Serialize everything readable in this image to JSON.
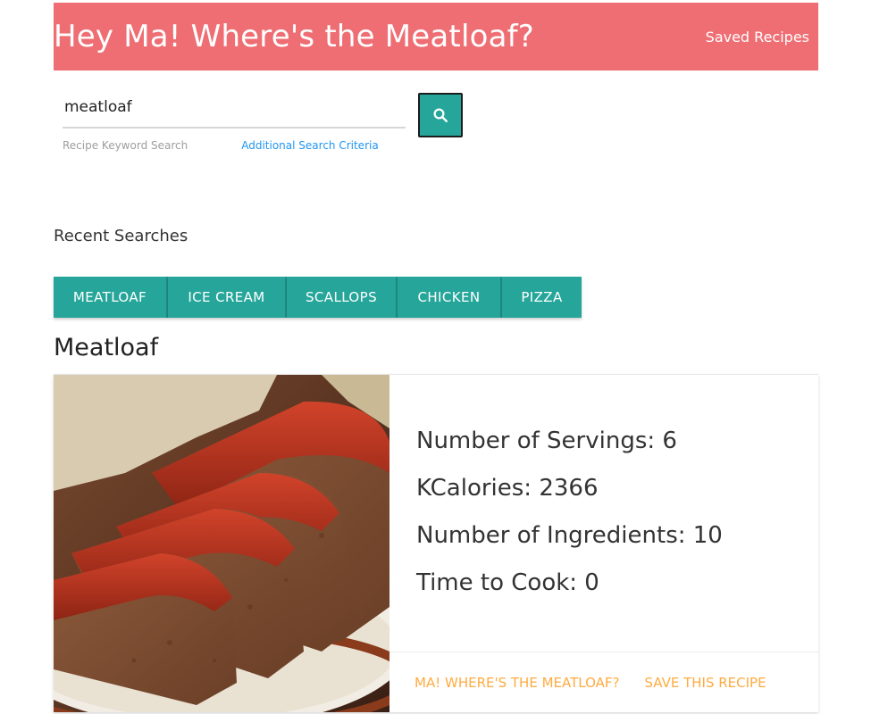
{
  "navbar": {
    "brand": "Hey Ma! Where's the Meatloaf?",
    "saved_link": "Saved Recipes"
  },
  "search": {
    "value": "meatloaf",
    "helper_label": "Recipe Keyword Search",
    "additional_link": "Additional Search Criteria",
    "button_icon": "search-icon"
  },
  "recent": {
    "title": "Recent Searches",
    "chips": [
      "MEATLOAF",
      "ICE CREAM",
      "SCALLOPS",
      "CHICKEN",
      "PIZZA"
    ]
  },
  "recipe": {
    "title": "Meatloaf",
    "image_alt": "meatloaf",
    "stats": {
      "servings": "Number of Servings: 6",
      "kcal": "KCalories: 2366",
      "ingredients": "Number of Ingredients: 10",
      "time": "Time to Cook: 0"
    },
    "actions": {
      "primary": "MA! WHERE'S THE MEATLOAF?",
      "save": "SAVE THIS RECIPE"
    }
  },
  "colors": {
    "navbar": "#ee6e73",
    "teal": "#26a69a",
    "link_blue": "#2196f3",
    "action_orange": "#ffab40"
  }
}
